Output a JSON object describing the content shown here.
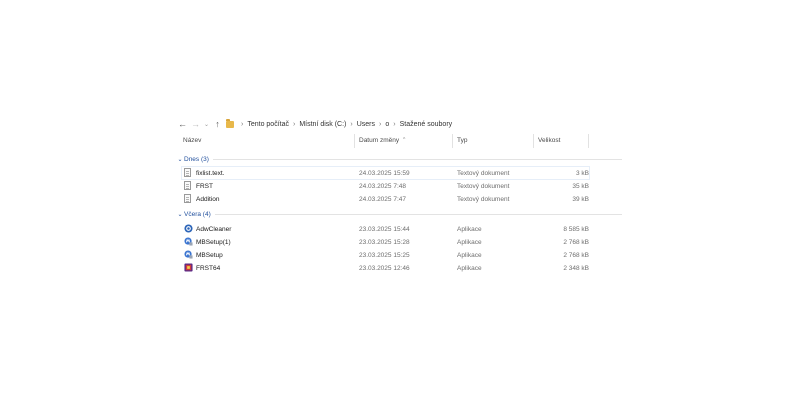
{
  "address": {
    "back_icon": "←",
    "forward_icon": "→",
    "history_icon": "⌄",
    "up_icon": "↑",
    "crumbs": [
      "Tento počítač",
      "Místní disk (C:)",
      "Users",
      "o",
      "Stažené soubory"
    ],
    "separator": "›"
  },
  "columns": {
    "name": "Název",
    "date": "Datum změny",
    "type": "Typ",
    "size": "Velikost",
    "sort_indicator": "^"
  },
  "groups": [
    {
      "label": "Dnes (3)",
      "items": [
        {
          "name": "fixlist.text.",
          "date": "24.03.2025 15:59",
          "type": "Textový dokument",
          "size": "3 kB",
          "icon": "text-document-icon"
        },
        {
          "name": "FRST",
          "date": "24.03.2025 7:48",
          "type": "Textový dokument",
          "size": "35 kB",
          "icon": "text-document-icon"
        },
        {
          "name": "Addition",
          "date": "24.03.2025 7:47",
          "type": "Textový dokument",
          "size": "39 kB",
          "icon": "text-document-icon"
        }
      ]
    },
    {
      "label": "Včera (4)",
      "items": [
        {
          "name": "AdwCleaner",
          "date": "23.03.2025 15:44",
          "type": "Aplikace",
          "size": "8 585 kB",
          "icon": "adwcleaner-app-icon"
        },
        {
          "name": "MBSetup(1)",
          "date": "23.03.2025 15:28",
          "type": "Aplikace",
          "size": "2 768 kB",
          "icon": "malwarebytes-setup-icon"
        },
        {
          "name": "MBSetup",
          "date": "23.03.2025 15:25",
          "type": "Aplikace",
          "size": "2 768 kB",
          "icon": "malwarebytes-setup-icon"
        },
        {
          "name": "FRST64",
          "date": "23.03.2025 12:46",
          "type": "Aplikace",
          "size": "2 348 kB",
          "icon": "frst64-app-icon"
        }
      ]
    }
  ],
  "colors": {
    "group_label": "#1f4e9c",
    "folder": "#e8b84a"
  }
}
